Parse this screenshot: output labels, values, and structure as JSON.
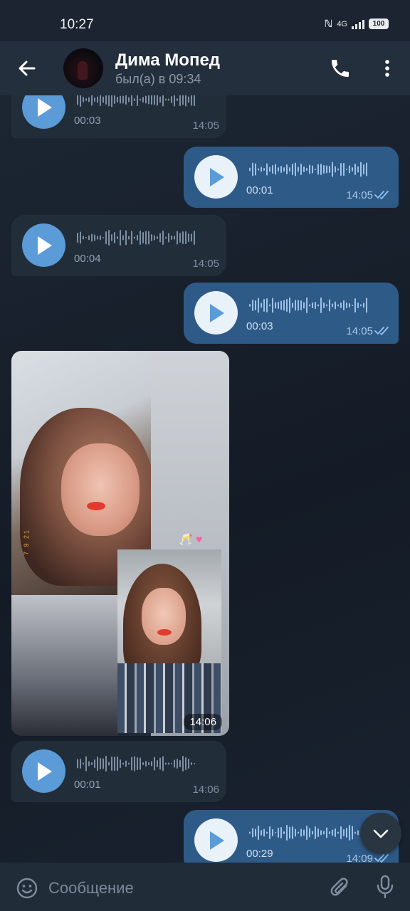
{
  "status_bar": {
    "time": "10:27",
    "network": "4G",
    "battery": "100"
  },
  "header": {
    "name": "Дима Мопед",
    "status": "был(а) в 09:34"
  },
  "messages": [
    {
      "direction": "in",
      "duration": "00:03",
      "time": "14:05"
    },
    {
      "direction": "out",
      "duration": "00:01",
      "time": "14:05",
      "read": true
    },
    {
      "direction": "in",
      "duration": "00:04",
      "time": "14:05"
    },
    {
      "direction": "out",
      "duration": "00:03",
      "time": "14:05",
      "read": true
    },
    {
      "direction": "in",
      "type": "photo",
      "time": "14:06",
      "overlay_text": "7 9 21"
    },
    {
      "direction": "in",
      "duration": "00:01",
      "time": "14:06"
    },
    {
      "direction": "out",
      "duration": "00:29",
      "time": "14:09",
      "read": true
    }
  ],
  "composer": {
    "placeholder": "Сообщение"
  },
  "colors": {
    "background": "#17202c",
    "header": "#242f3d",
    "incoming_bubble": "#222d3a",
    "outgoing_bubble": "#2e5a87",
    "accent": "#5b9bd8"
  }
}
